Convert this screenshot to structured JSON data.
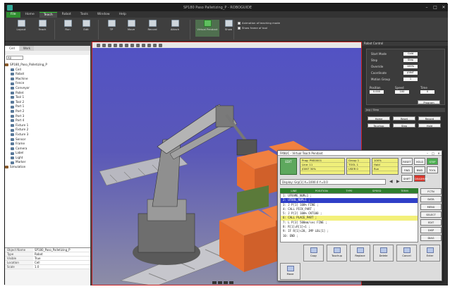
{
  "window": {
    "title": "SP180 Paso Palletizing_P - ROBOGUIDE"
  },
  "menu_tabs": [
    "File",
    "Home",
    "Teach",
    "Robot",
    "Tools",
    "Window",
    "Help"
  ],
  "ribbon": {
    "buttons": [
      "Layout",
      "Teach",
      "Run",
      "Edit",
      "TP",
      "Move",
      "Record",
      "Attach",
      "Virtual Pendant",
      "Show"
    ],
    "checkboxes": [
      "Animation of teaching mode",
      "Show frame of tool"
    ]
  },
  "tree": {
    "tabs": [
      "Cell",
      "Work"
    ],
    "filter": "All",
    "root": "SP180_Paso_Palletizing_P",
    "items": [
      "Cell",
      "Robot",
      "Machine",
      "Fence",
      "Conveyor",
      "Pallet",
      "Tool 1",
      "Tool 2",
      "Part 1",
      "Part 2",
      "Part 3",
      "Part 4",
      "Fixture 1",
      "Fixture 2",
      "Fixture 3",
      "Sensor",
      "Frame",
      "Camera",
      "Label",
      "Light",
      "Marker"
    ],
    "extra": "Simulation",
    "props": [
      {
        "k": "Object Name",
        "v": "SP180_Paso_Palletizing_P"
      },
      {
        "k": "Type",
        "v": "Robot"
      },
      {
        "k": "Visible",
        "v": "True"
      },
      {
        "k": "Location",
        "v": "Cell"
      },
      {
        "k": "Scale",
        "v": "1.0"
      }
    ]
  },
  "control": {
    "header": "Robot Control",
    "fields": [
      {
        "label": "Start Mode",
        "value": "Cold"
      },
      {
        "label": "Step",
        "value": "Step"
      },
      {
        "label": "Override",
        "value": "100%"
      },
      {
        "label": "Coordinate",
        "value": "JOINT"
      },
      {
        "label": "Motion Group",
        "value": "1"
      }
    ],
    "tcp_fields": [
      {
        "label": "Position",
        "value": "0.000"
      },
      {
        "label": "Speed",
        "value": "100"
      },
      {
        "label": "Time",
        "value": "0"
      }
    ],
    "program_button": "Program",
    "jog_header": "Jog / Step",
    "jog_buttons": [
      "Home",
      "Reset",
      "Record",
      "Touchup",
      "Step",
      "Hold"
    ]
  },
  "pendant": {
    "title": "FANUC - Virtual Teach Pendant",
    "edit_label": "EDIT",
    "status_cols": [
      [
        "Prog: PNS0001",
        "Line: 11",
        "JOINT 30%"
      ],
      [
        "Group 1",
        "TOOL 1",
        "USER 0"
      ],
      [
        "100%",
        "Hold",
        "Run"
      ]
    ],
    "path": "Display: Grp[1] X=1000.0  Y=0.0",
    "columns": [
      "LINE",
      "POSITION",
      "TYPE",
      "SPEED",
      "TERM"
    ],
    "lines": [
      {
        "text": "1:  UFRAME_NUM=1 ;",
        "style": ""
      },
      {
        "text": "2:  UTOOL_NUM=1 ;",
        "style": "blue"
      },
      {
        "text": "3:  J P[1] 100% FINE ;",
        "style": ""
      },
      {
        "text": "4:  CALL PICK_PART ;",
        "style": ""
      },
      {
        "text": "5:  J P[2] 100% CNT100 ;",
        "style": ""
      },
      {
        "text": "6:  CALL PLACE_PART ;",
        "style": "yel"
      },
      {
        "text": "7:  L P[3] 500mm/sec FINE ;",
        "style": ""
      },
      {
        "text": "8:  R[1]=R[1]+1 ;",
        "style": ""
      },
      {
        "text": "9:  IF R[1]<20, JMP LBL[1] ;",
        "style": ""
      },
      {
        "text": "10: END ;",
        "style": ""
      }
    ],
    "right_buttons": [
      "POSN",
      "I/O",
      "STATUS",
      "ALARM"
    ],
    "top_buttons": [
      "RESET",
      "HOLD",
      "STEP",
      "FWD",
      "BWD",
      "TOOL",
      "SHIFT",
      "DEADMAN"
    ],
    "side_buttons": [
      "FCTN",
      "DATA",
      "MENU",
      "SELECT",
      "EDIT",
      "DISP",
      "DIAG"
    ],
    "softkeys": [
      "Move",
      "Copy",
      "Touchup",
      "Replace",
      "Delete",
      "Cancel",
      "Enter"
    ]
  }
}
